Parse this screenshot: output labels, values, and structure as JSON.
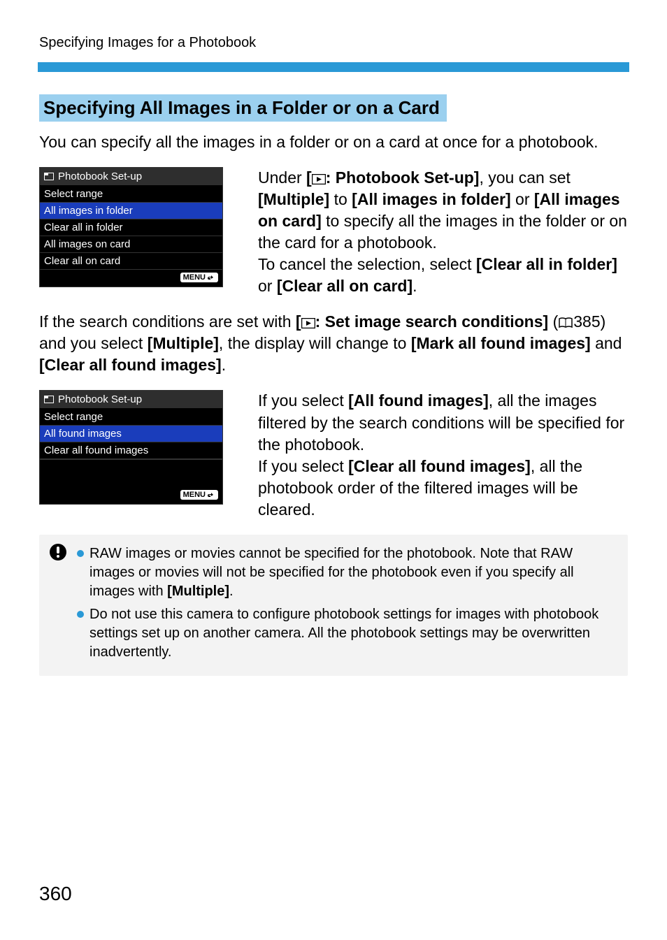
{
  "breadcrumb": "Specifying Images for a Photobook",
  "section_title": "Specifying All Images in a Folder or on a Card",
  "intro": "You can specify all the images in a folder or on a card at once for a photobook.",
  "sim1": {
    "title": "Photobook Set-up",
    "items": [
      "Select range",
      "All images in folder",
      "Clear all in folder",
      "All images on card",
      "Clear all on card"
    ],
    "selected_index": 1,
    "menu_label": "MENU"
  },
  "para1": {
    "pre": "Under ",
    "b1": ": Photobook Set-up]",
    "t1": ", you can set ",
    "b2": "[Multiple]",
    "t2": " to ",
    "b3": "[All images in folder]",
    "t3": " or ",
    "b4": "[All images on card]",
    "t4": " to specify all the images in the folder or on the card for a photobook.",
    "t5": "To cancel the selection, select ",
    "b5": "[Clear all in folder]",
    "t6": " or ",
    "b6": "[Clear all on card]",
    "t7": "."
  },
  "para2": {
    "t1": "If the search conditions are set with ",
    "b1": ": Set image search conditions]",
    "t2": " (",
    "ref": "385",
    "t3": ") and you select ",
    "b2": "[Multiple]",
    "t4": ", the display will change to ",
    "b3": "[Mark all found images]",
    "t5": " and ",
    "b4": "[Clear all found images]",
    "t6": "."
  },
  "sim2": {
    "title": "Photobook Set-up",
    "items": [
      "Select range",
      "All found images",
      "Clear all found images"
    ],
    "selected_index": 1,
    "menu_label": "MENU"
  },
  "para3": {
    "t1": "If you select ",
    "b1": "[All found images]",
    "t2": ", all the images filtered by the search conditions will be specified for the photobook.",
    "t3": "If you select ",
    "b2": "[Clear all found images]",
    "t4": ", all the photobook order of the filtered images will be cleared."
  },
  "caution": {
    "items": [
      {
        "t1": "RAW images or movies cannot be specified for the photobook. Note that RAW images or movies will not be specified for the photobook even if you specify all images with ",
        "b1": "[Multiple]",
        "t2": "."
      },
      {
        "t1": "Do not use this camera to configure photobook settings for images with photobook settings set up on another camera. All the photobook settings may be overwritten inadvertently."
      }
    ]
  },
  "page_number": "360"
}
